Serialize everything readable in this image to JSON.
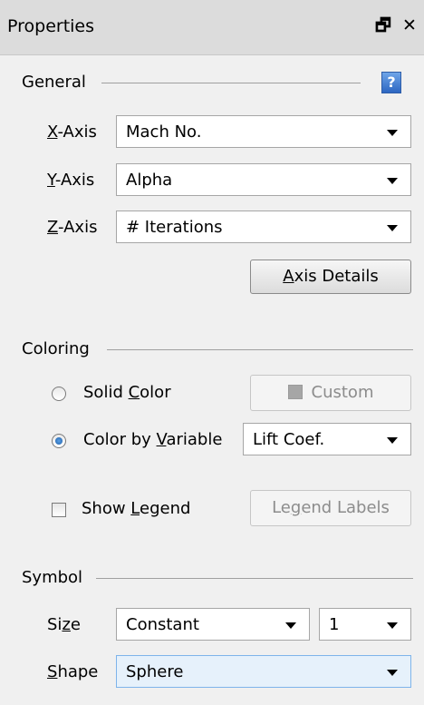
{
  "window": {
    "title": "Properties",
    "restore_glyph": "🗗",
    "close_glyph": "✕"
  },
  "general": {
    "label": "General",
    "help_glyph": "?",
    "x_axis": {
      "label_mnemonic": "X",
      "label_rest": "-Axis",
      "value": "Mach No."
    },
    "y_axis": {
      "label_mnemonic": "Y",
      "label_rest": "-Axis",
      "value": "Alpha"
    },
    "z_axis": {
      "label_mnemonic": "Z",
      "label_rest": "-Axis",
      "value": "# Iterations"
    },
    "axis_details": {
      "mnemonic": "A",
      "rest": "xis Details"
    }
  },
  "coloring": {
    "label": "Coloring",
    "solid_color": {
      "pre": "Solid ",
      "mnemonic": "C",
      "post": "olor",
      "selected": false
    },
    "custom_button": "Custom",
    "color_by_variable": {
      "pre": "Color by ",
      "mnemonic": "V",
      "post": "ariable",
      "selected": true
    },
    "variable_value": "Lift Coef.",
    "show_legend": {
      "pre": "Show ",
      "mnemonic": "L",
      "post": "egend",
      "checked": false
    },
    "legend_labels": {
      "pre": "Le",
      "mnemonic": "g",
      "post": "end Labels"
    }
  },
  "symbol": {
    "label": "Symbol",
    "size": {
      "pre": "Si",
      "mnemonic": "z",
      "post": "e",
      "mode_value": "Constant",
      "number_value": "1"
    },
    "shape": {
      "pre": "",
      "mnemonic": "S",
      "post": "hape",
      "value": "Sphere"
    }
  },
  "colors": {
    "titlebar": "#dcdcdc",
    "panel": "#f0f0f0",
    "help_icon": "#2d66c2",
    "radio_dot": "#1f5fa8",
    "selected_combo": "#e6f1fb"
  }
}
